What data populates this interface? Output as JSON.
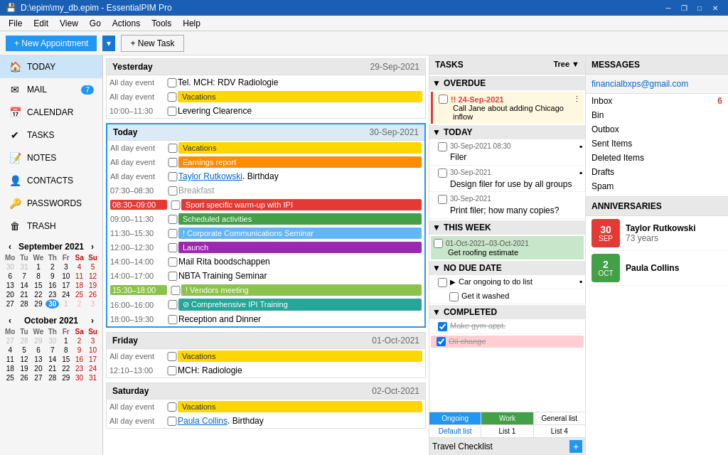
{
  "titleBar": {
    "title": "D:\\epim\\my_db.epim - EssentialPIM Pro",
    "controls": [
      "minimize",
      "maximize",
      "restore",
      "close"
    ]
  },
  "menu": {
    "items": [
      "File",
      "Edit",
      "View",
      "Go",
      "Actions",
      "Tools",
      "Help"
    ]
  },
  "toolbar": {
    "newAppointment": "+ New Appointment",
    "newTask": "+ New Task"
  },
  "sidebar": {
    "navItems": [
      {
        "id": "today",
        "label": "TODAY",
        "icon": "🏠",
        "badge": null,
        "active": true
      },
      {
        "id": "mail",
        "label": "MAIL",
        "icon": "✉",
        "badge": "7",
        "active": false
      },
      {
        "id": "calendar",
        "label": "CALENDAR",
        "icon": "📅",
        "badge": null,
        "active": false
      },
      {
        "id": "tasks",
        "label": "TASKS",
        "icon": "✔",
        "badge": null,
        "active": false
      },
      {
        "id": "notes",
        "label": "NOTES",
        "icon": "📝",
        "badge": null,
        "active": false
      },
      {
        "id": "contacts",
        "label": "CONTACTS",
        "icon": "👤",
        "badge": null,
        "active": false
      },
      {
        "id": "passwords",
        "label": "PASSWORDS",
        "icon": "🔑",
        "badge": null,
        "active": false
      },
      {
        "id": "trash",
        "label": "TRASH",
        "icon": "🗑",
        "badge": null,
        "active": false
      }
    ],
    "calendar1": {
      "month": "September 2021",
      "days": [
        "Mo",
        "Tu",
        "We",
        "Th",
        "Fr",
        "Sa",
        "Su"
      ],
      "weeks": [
        [
          {
            "d": "30",
            "cls": "other-month"
          },
          {
            "d": "31",
            "cls": "other-month"
          },
          {
            "d": "1",
            "cls": ""
          },
          {
            "d": "2",
            "cls": ""
          },
          {
            "d": "3",
            "cls": ""
          },
          {
            "d": "4",
            "cls": "red"
          },
          {
            "d": "5",
            "cls": "red"
          }
        ],
        [
          {
            "d": "6",
            "cls": ""
          },
          {
            "d": "7",
            "cls": ""
          },
          {
            "d": "8",
            "cls": ""
          },
          {
            "d": "9",
            "cls": ""
          },
          {
            "d": "10",
            "cls": ""
          },
          {
            "d": "11",
            "cls": "red"
          },
          {
            "d": "12",
            "cls": "red"
          }
        ],
        [
          {
            "d": "13",
            "cls": ""
          },
          {
            "d": "14",
            "cls": ""
          },
          {
            "d": "15",
            "cls": ""
          },
          {
            "d": "16",
            "cls": ""
          },
          {
            "d": "17",
            "cls": ""
          },
          {
            "d": "18",
            "cls": "red"
          },
          {
            "d": "19",
            "cls": "red"
          }
        ],
        [
          {
            "d": "20",
            "cls": ""
          },
          {
            "d": "21",
            "cls": ""
          },
          {
            "d": "22",
            "cls": ""
          },
          {
            "d": "23",
            "cls": ""
          },
          {
            "d": "24",
            "cls": ""
          },
          {
            "d": "25",
            "cls": "red"
          },
          {
            "d": "26",
            "cls": "red"
          }
        ],
        [
          {
            "d": "27",
            "cls": ""
          },
          {
            "d": "28",
            "cls": ""
          },
          {
            "d": "29",
            "cls": ""
          },
          {
            "d": "30",
            "cls": "today"
          },
          {
            "d": "1",
            "cls": "other-month"
          },
          {
            "d": "2",
            "cls": "other-month red"
          },
          {
            "d": "3",
            "cls": "other-month red"
          }
        ]
      ]
    },
    "calendar2": {
      "month": "October 2021",
      "days": [
        "Mo",
        "Tu",
        "We",
        "Th",
        "Fr",
        "Sa",
        "Su"
      ],
      "weeks": [
        [
          {
            "d": "27",
            "cls": "other-month"
          },
          {
            "d": "28",
            "cls": "other-month"
          },
          {
            "d": "29",
            "cls": "other-month"
          },
          {
            "d": "30",
            "cls": "other-month"
          },
          {
            "d": "1",
            "cls": ""
          },
          {
            "d": "2",
            "cls": "red"
          },
          {
            "d": "3",
            "cls": "red"
          }
        ],
        [
          {
            "d": "4",
            "cls": ""
          },
          {
            "d": "5",
            "cls": ""
          },
          {
            "d": "6",
            "cls": ""
          },
          {
            "d": "7",
            "cls": ""
          },
          {
            "d": "8",
            "cls": ""
          },
          {
            "d": "9",
            "cls": "red"
          },
          {
            "d": "10",
            "cls": "red"
          }
        ],
        [
          {
            "d": "11",
            "cls": ""
          },
          {
            "d": "12",
            "cls": ""
          },
          {
            "d": "13",
            "cls": ""
          },
          {
            "d": "14",
            "cls": ""
          },
          {
            "d": "15",
            "cls": ""
          },
          {
            "d": "16",
            "cls": "red"
          },
          {
            "d": "17",
            "cls": "red"
          }
        ],
        [
          {
            "d": "18",
            "cls": ""
          },
          {
            "d": "19",
            "cls": ""
          },
          {
            "d": "20",
            "cls": ""
          },
          {
            "d": "21",
            "cls": ""
          },
          {
            "d": "22",
            "cls": ""
          },
          {
            "d": "23",
            "cls": "red"
          },
          {
            "d": "24",
            "cls": "red"
          }
        ],
        [
          {
            "d": "25",
            "cls": ""
          },
          {
            "d": "26",
            "cls": ""
          },
          {
            "d": "27",
            "cls": ""
          },
          {
            "d": "28",
            "cls": ""
          },
          {
            "d": "29",
            "cls": ""
          },
          {
            "d": "30",
            "cls": "red"
          },
          {
            "d": "31",
            "cls": "red"
          }
        ]
      ]
    }
  },
  "appointments": {
    "yesterday": {
      "label": "Yesterday",
      "date": "29-Sep-2021",
      "events": [
        {
          "time": "All day event",
          "type": "text",
          "text": "Tel. MCH: RDV Radiologie",
          "color": null
        },
        {
          "time": "All day event",
          "type": "bar",
          "text": "Vacations",
          "color": "allday-yellow"
        },
        {
          "time": "10:00–11:30",
          "type": "text",
          "text": "Levering Clearence",
          "color": null
        }
      ]
    },
    "today": {
      "label": "Today",
      "date": "30-Sep-2021",
      "events": [
        {
          "time": "All day event",
          "type": "bar",
          "text": "Vacations",
          "color": "allday-yellow"
        },
        {
          "time": "All day event",
          "type": "bar",
          "text": "Earnings report",
          "color": "allday-orange"
        },
        {
          "time": "All day event",
          "type": "link",
          "text": "Taylor Rutkowski",
          "suffix": ". Birthday",
          "color": null
        },
        {
          "time": "07:30–08:30",
          "type": "text",
          "text": "Breakfast",
          "color": null
        },
        {
          "time": "08:30–09:00",
          "type": "bar",
          "text": "Sport specific warm-up with IPI",
          "color": "event-red"
        },
        {
          "time": "09:00–11:30",
          "type": "bar",
          "text": "Scheduled activities",
          "color": "event-green"
        },
        {
          "time": "11:30–15:30",
          "type": "bar",
          "text": "! Corporate Communications Seminar",
          "color": "event-blue-light"
        },
        {
          "time": "12:00–12:30",
          "type": "bar",
          "text": "Launch",
          "color": "event-purple"
        },
        {
          "time": "14:00–14:00",
          "type": "text",
          "text": "Mail Rita boodschappen",
          "color": null
        },
        {
          "time": "14:00–17:00",
          "type": "text",
          "text": "NBTA Training Seminar",
          "color": null
        },
        {
          "time": "15:30–18:00",
          "type": "bar",
          "text": "! Vendors meeting",
          "color": "event-lime"
        },
        {
          "time": "16:00–16:00",
          "type": "bar",
          "text": "⊘ Comprehensive IPI Training",
          "color": "event-teal"
        },
        {
          "time": "18:00–19:30",
          "type": "text",
          "text": "Reception and Dinner",
          "color": null
        }
      ]
    },
    "friday": {
      "label": "Friday",
      "date": "01-Oct-2021",
      "events": [
        {
          "time": "All day event",
          "type": "bar",
          "text": "Vacations",
          "color": "allday-yellow"
        },
        {
          "time": "12:10–13:00",
          "type": "text",
          "text": "MCH: Radiologie",
          "color": null
        }
      ]
    },
    "saturday": {
      "label": "Saturday",
      "date": "02-Oct-2021",
      "events": [
        {
          "time": "All day event",
          "type": "bar",
          "text": "Vacations",
          "color": "allday-yellow"
        },
        {
          "time": "All day event",
          "type": "link",
          "text": "Paula Collins",
          "suffix": ". Birthday",
          "color": null
        }
      ]
    }
  },
  "tasks": {
    "header": "TASKS",
    "treeLabel": "Tree ▼",
    "sections": {
      "overdue": {
        "label": "OVERDUE",
        "items": [
          {
            "date": "24-Sep-2021",
            "text": "Call Jane about adding Chicago inflow",
            "overdue": true,
            "done": false
          }
        ]
      },
      "today": {
        "label": "TODAY",
        "items": [
          {
            "date": "30-Sep-2021 08:30",
            "text": "Filer",
            "done": false
          },
          {
            "date": "30-Sep-2021",
            "text": "Design filer for use by all groups",
            "done": false
          },
          {
            "date": "30-Sep-2021",
            "text": "Print filer; how many copies?",
            "done": false
          }
        ]
      },
      "thisWeek": {
        "label": "THIS WEEK",
        "items": [
          {
            "date": "01-Oct-2021–03-Oct-2021",
            "text": "Get roofing estimate",
            "done": false,
            "highlight": true
          }
        ]
      },
      "noDate": {
        "label": "NO DUE DATE",
        "items": [
          {
            "text": "Car ongoing to do list",
            "done": false,
            "hasChildren": true
          },
          {
            "text": "Get it washed",
            "done": false,
            "indent": true
          }
        ]
      },
      "completed": {
        "label": "COMPLETED",
        "items": [
          {
            "text": "Make gym appt.",
            "done": true
          },
          {
            "text": "Oil change",
            "done": true,
            "highlight": true
          }
        ]
      }
    },
    "tabs1": [
      {
        "label": "Ongoing",
        "active": true
      },
      {
        "label": "Work",
        "active": false
      },
      {
        "label": "General list",
        "active": false
      }
    ],
    "tabs2": [
      {
        "label": "Default list",
        "active": false
      },
      {
        "label": "List 1",
        "active": false
      },
      {
        "label": "List 4",
        "active": false
      }
    ],
    "footer": "Travel Checklist"
  },
  "messages": {
    "header": "MESSAGES",
    "account": "financialbxps@gmail.com",
    "items": [
      {
        "label": "Inbox",
        "count": "6"
      },
      {
        "label": "Bin",
        "count": ""
      },
      {
        "label": "Outbox",
        "count": ""
      },
      {
        "label": "Sent Items",
        "count": ""
      },
      {
        "label": "Deleted Items",
        "count": ""
      },
      {
        "label": "Drafts",
        "count": ""
      },
      {
        "label": "Spam",
        "count": ""
      }
    ]
  },
  "anniversaries": {
    "header": "ANNIVERSARIES",
    "items": [
      {
        "day": "30",
        "month": "SEP",
        "color": "#e53935",
        "name": "Taylor Rutkowski",
        "years": "73 years"
      },
      {
        "day": "2",
        "month": "OCT",
        "color": "#43a047",
        "name": "Paula Collins",
        "years": ""
      }
    ]
  }
}
